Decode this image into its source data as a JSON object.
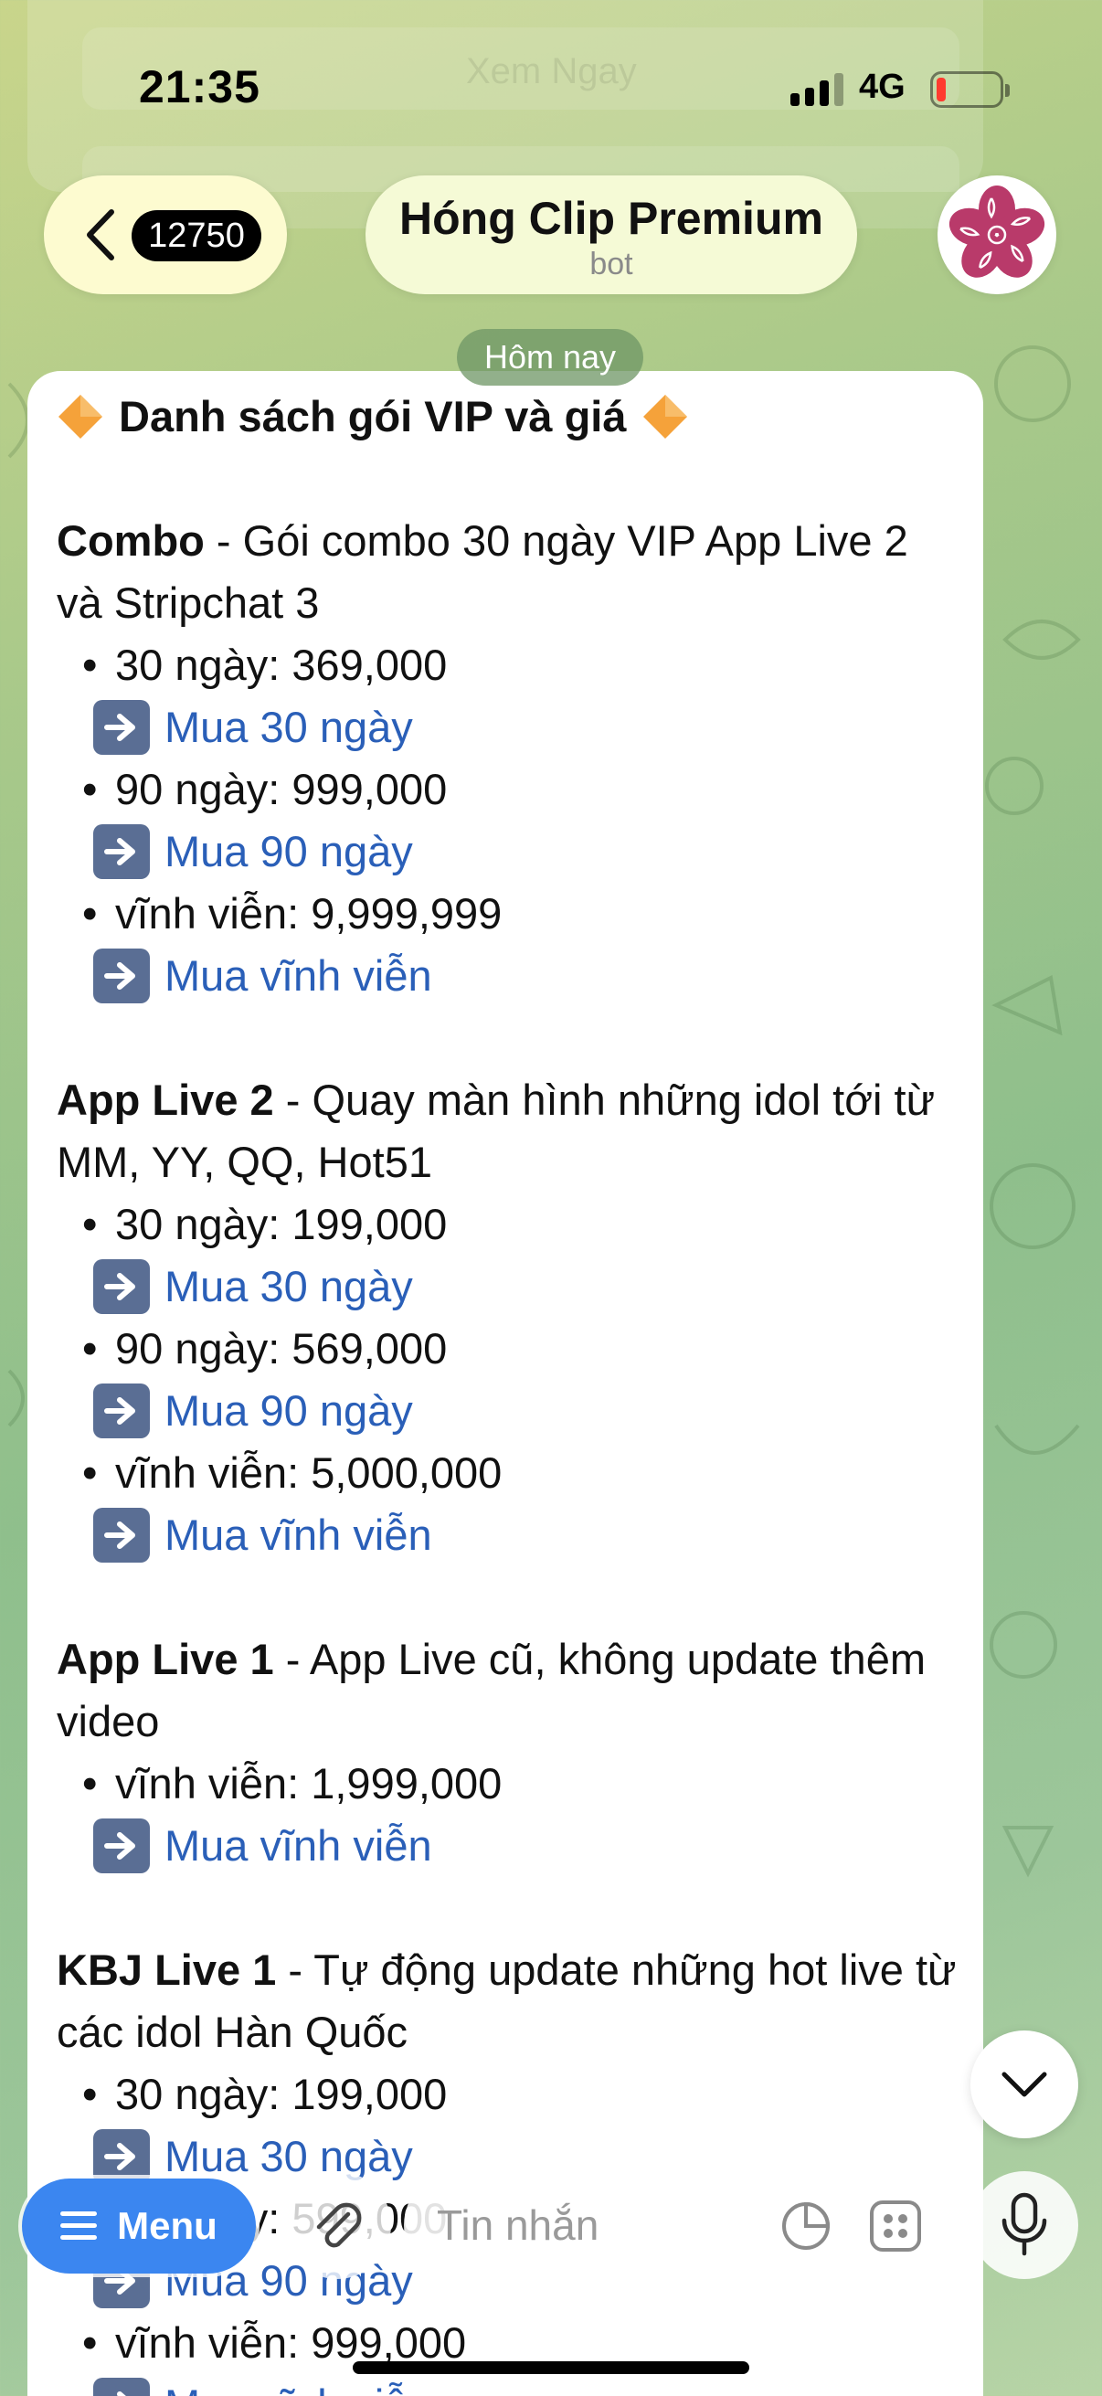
{
  "status_bar": {
    "time": "21:35",
    "network": "4G"
  },
  "ghost": {
    "line1": "Xem Ngay"
  },
  "header": {
    "back_count": "12750",
    "title": "Hóng Clip Premium",
    "subtitle": "bot"
  },
  "date_chip": "Hôm nay",
  "message": {
    "heading": "Danh sách gói VIP và giá",
    "sections": [
      {
        "name": "Combo",
        "desc": " - Gói combo 30 ngày VIP App Live 2 và Stripchat 3",
        "items": [
          {
            "text": "30 ngày: 369,000",
            "link": "Mua 30 ngày"
          },
          {
            "text": "90 ngày: 999,000",
            "link": "Mua 90 ngày"
          },
          {
            "text": "vĩnh viễn: 9,999,999",
            "link": "Mua vĩnh viễn"
          }
        ]
      },
      {
        "name": "App Live 2",
        "desc": " - Quay màn hình những idol tới từ MM, YY, QQ, Hot51",
        "items": [
          {
            "text": "30 ngày: 199,000",
            "link": "Mua 30 ngày"
          },
          {
            "text": "90 ngày: 569,000",
            "link": "Mua 90 ngày"
          },
          {
            "text": "vĩnh viễn: 5,000,000",
            "link": "Mua vĩnh viễn"
          }
        ]
      },
      {
        "name": "App Live 1",
        "desc": " - App Live cũ, không update thêm video",
        "items": [
          {
            "text": "vĩnh viễn: 1,999,000",
            "link": "Mua vĩnh viễn"
          }
        ]
      },
      {
        "name": "KBJ Live 1",
        "desc": " - Tự động update những hot live từ các idol Hàn Quốc",
        "items": [
          {
            "text": "30 ngày: 199,000",
            "link": "Mua 30 ngày"
          },
          {
            "text": "90 ngày: 599,000",
            "link": "Mua 90 ngày"
          },
          {
            "text": "vĩnh viễn: 999,000",
            "link": "Mua vĩnh viễn"
          }
        ]
      }
    ]
  },
  "bottom_bar": {
    "menu_label": "Menu",
    "input_placeholder": "Tin nhắn"
  },
  "colors": {
    "accent": "#3b86f0",
    "link": "#2a5fb8",
    "bubble": "#ffffff",
    "diamond": "#f5a23a"
  }
}
